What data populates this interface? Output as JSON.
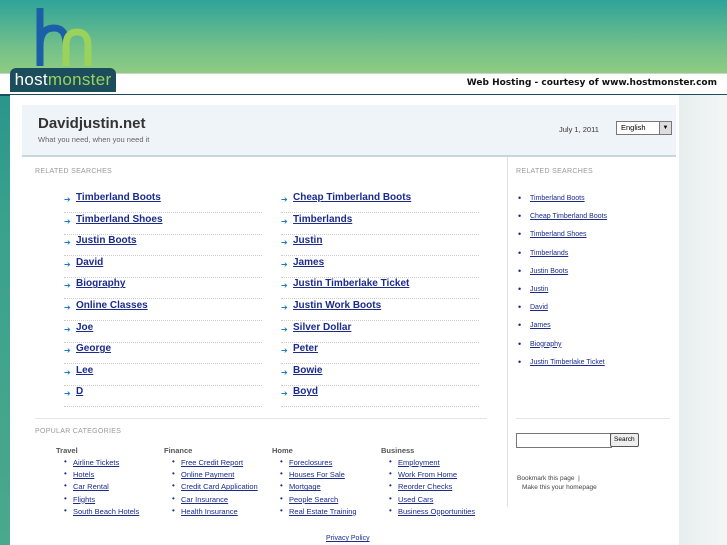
{
  "brand": {
    "logo_host": "host",
    "logo_monster": "monster"
  },
  "hosting_strip": {
    "text": "Web Hosting - courtesy of www.hostmonster.com"
  },
  "header": {
    "title": "Davidjustin.net",
    "tagline": "What you need, when you need it",
    "date": "July 1, 2011",
    "language": "English"
  },
  "related_label": "RELATED SEARCHES",
  "related_left": [
    "Timberland Boots",
    "Timberland Shoes",
    "Justin Boots",
    "David",
    "Biography",
    "Online Classes",
    "Joe",
    "George",
    "Lee",
    "D"
  ],
  "related_right": [
    "Cheap Timberland Boots",
    "Timberlands",
    "Justin",
    "James",
    "Justin Timberlake Ticket",
    "Justin Work Boots",
    "Silver Dollar",
    "Peter",
    "Bowie",
    "Boyd"
  ],
  "sidebar": {
    "label": "RELATED SEARCHES",
    "items": [
      "Timberland Boots",
      "Cheap Timberland Boots",
      "Timberland Shoes",
      "Timberlands",
      "Justin Boots",
      "Justin",
      "David",
      "James",
      "Biography",
      "Justin Timberlake Ticket"
    ],
    "search_button": "Search",
    "bookmark": "Bookmark this page",
    "homepage": "Make this your homepage"
  },
  "popular": {
    "label": "POPULAR CATEGORIES",
    "columns": [
      {
        "head": "Travel",
        "items": [
          "Airline Tickets",
          "Hotels",
          "Car Rental",
          "Flights",
          "South Beach Hotels"
        ]
      },
      {
        "head": "Finance",
        "items": [
          "Free Credit Report",
          "Online Payment",
          "Credit Card Application",
          "Car Insurance",
          "Health Insurance"
        ]
      },
      {
        "head": "Home",
        "items": [
          "Foreclosures",
          "Houses For Sale",
          "Mortgage",
          "People Search",
          "Real Estate Training"
        ]
      },
      {
        "head": "Business",
        "items": [
          "Employment",
          "Work From Home",
          "Reorder Checks",
          "Used Cars",
          "Business Opportunities"
        ]
      }
    ]
  },
  "footer": {
    "privacy": "Privacy Policy"
  },
  "colors": {
    "link": "#1b2b8c",
    "brand_dark": "#1b4d5c",
    "brand_green": "#9ad25b"
  }
}
